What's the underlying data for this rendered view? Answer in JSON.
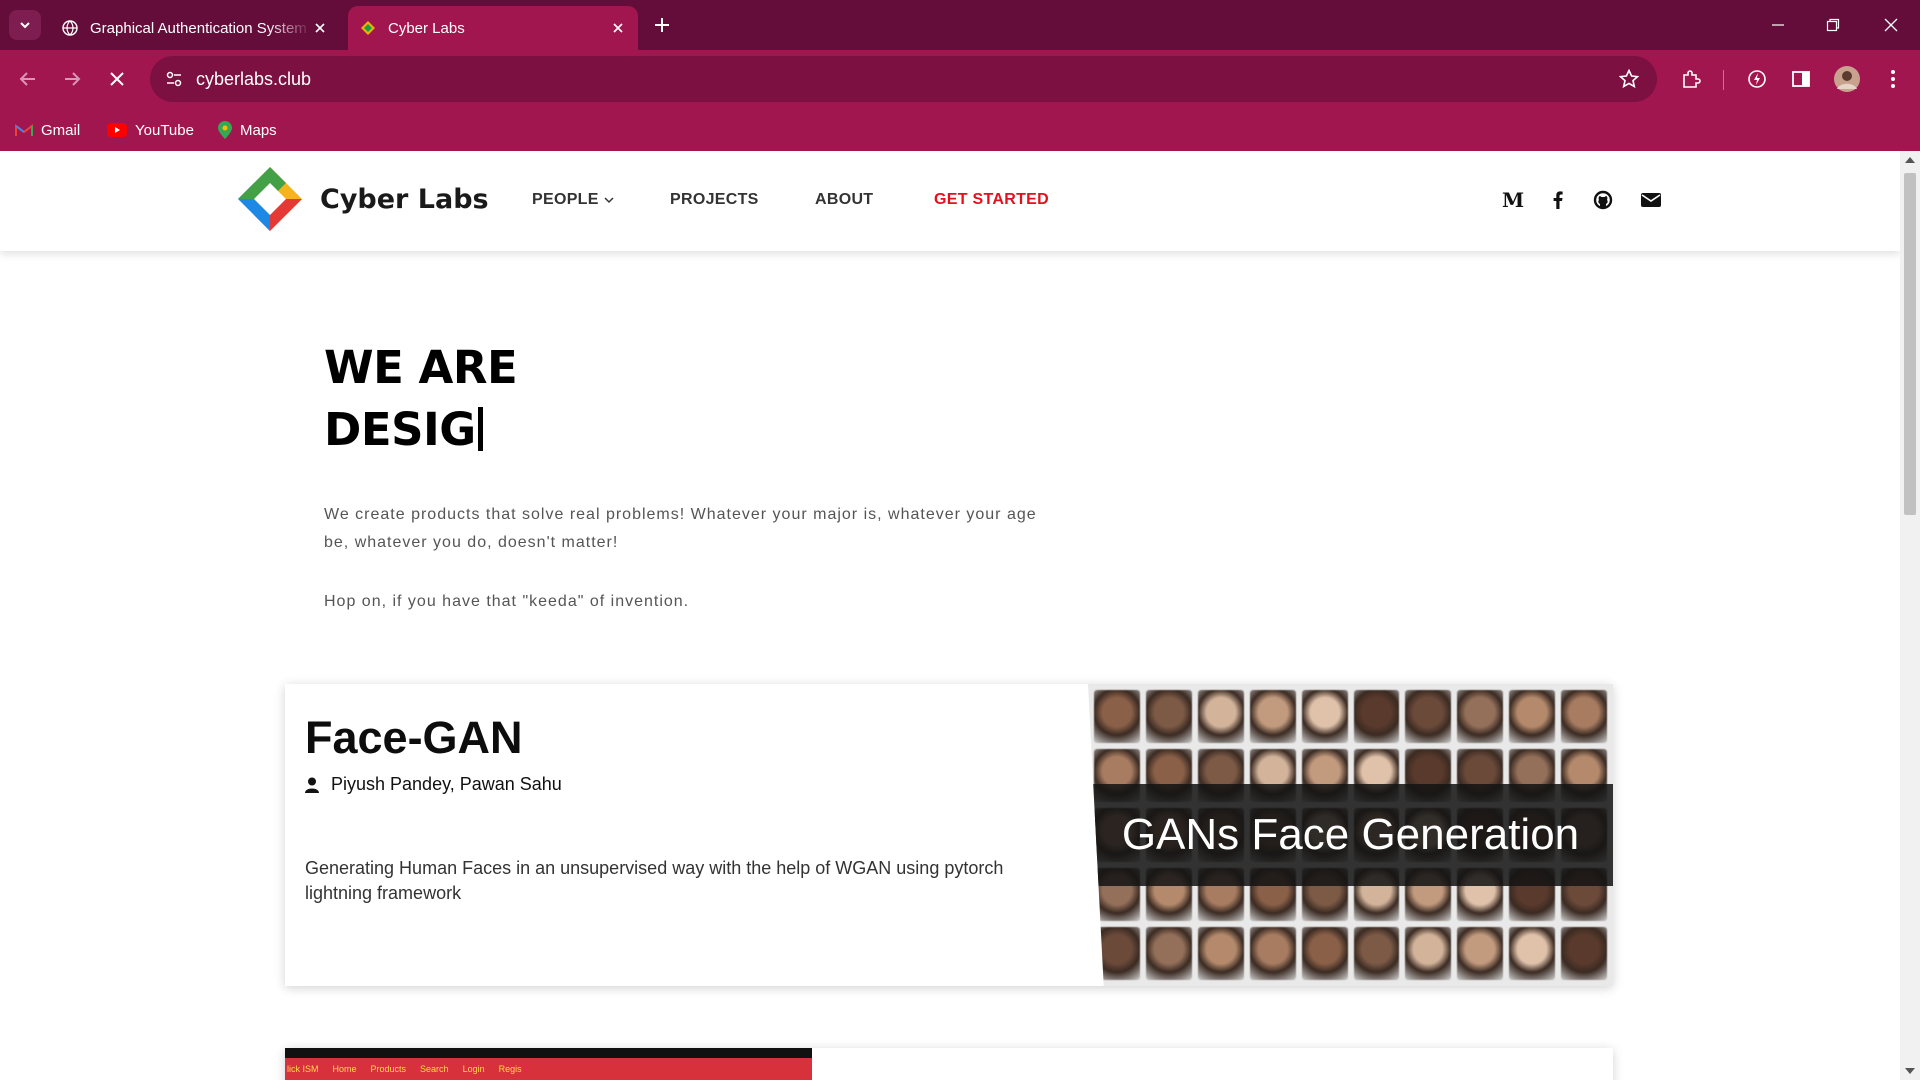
{
  "browser": {
    "tabs": [
      {
        "title": "Graphical Authentication System",
        "active": false
      },
      {
        "title": "Cyber Labs",
        "active": true
      }
    ],
    "address": "cyberlabs.club",
    "bookmarks": [
      {
        "label": "Gmail"
      },
      {
        "label": "YouTube"
      },
      {
        "label": "Maps"
      }
    ]
  },
  "site": {
    "brand": "Cyber Labs",
    "nav": {
      "people": "PEOPLE",
      "projects": "PROJECTS",
      "about": "ABOUT",
      "get_started": "GET STARTED"
    },
    "social_icons": [
      "medium-icon",
      "facebook-icon",
      "github-icon",
      "email-icon"
    ],
    "accent_color": "#e3101d"
  },
  "hero": {
    "title_line1": "WE ARE",
    "title_line2": "DESIG",
    "description": "We create products that solve real problems! Whatever your major is, whatever your age be, whatever you do, doesn't matter!",
    "hop": "Hop on, if you have that \"keeda\" of invention."
  },
  "project": {
    "title": "Face-GAN",
    "authors": "Piyush Pandey, Pawan Sahu",
    "description": "Generating Human Faces in an unsupervised way with the help of WGAN using pytorch lightning framework",
    "image_caption": "GANs Face Generation"
  },
  "project2_preview": {
    "strip_items": [
      "lick ISM",
      "Home",
      "Products",
      "Search",
      "Login",
      "Regis"
    ]
  }
}
